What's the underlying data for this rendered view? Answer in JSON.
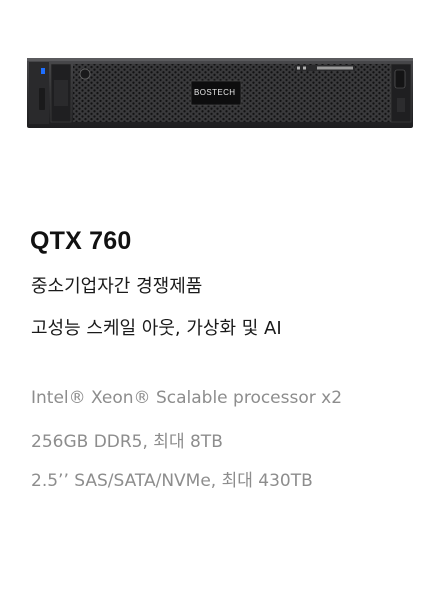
{
  "product": {
    "logo_text": "BOSTECH",
    "model": "QTX 760",
    "taglines": [
      "중소기업자간 경쟁제품",
      "고성능 스케일 아웃, 가상화 및 AI"
    ],
    "specs": [
      "Intel® Xeon® Scalable processor x2",
      "256GB DDR5, 최대 8TB",
      "2.5’’ SAS/SATA/NVMe, 최대 430TB"
    ]
  },
  "colors": {
    "title": "#111111",
    "tagline": "#1a1a1a",
    "spec": "#8d8d8d",
    "chassis": "#2e2e30",
    "status_led": "#1e6fff"
  }
}
